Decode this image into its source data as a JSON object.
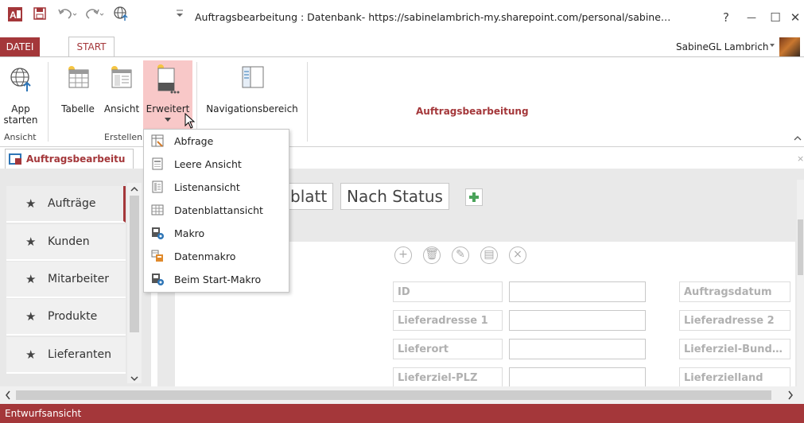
{
  "window": {
    "title": "Auftragsbearbeitung : Datenbank- https://sabinelambrich-my.sharepoint.com/personal/sabine…",
    "help": "?",
    "minimize": "—",
    "maximize": "☐",
    "close": "✕"
  },
  "tabs": {
    "datei": "DATEI",
    "start": "START"
  },
  "user": {
    "name": "SabineGL Lambrich"
  },
  "ribbon": {
    "app_starten_1": "App",
    "app_starten_2": "starten",
    "tabelle": "Tabelle",
    "ansicht": "Ansicht",
    "erweitert": "Erweitert",
    "navigationsbereich": "Navigationsbereich",
    "group_ansicht": "Ansicht",
    "group_erstellen": "Erstellen",
    "app_name": "Auftragsbearbeitung"
  },
  "dropdown": {
    "items": [
      {
        "label": "Abfrage",
        "icon": "query-icon"
      },
      {
        "label": "Leere Ansicht",
        "icon": "blank-view-icon"
      },
      {
        "label": "Listenansicht",
        "icon": "list-view-icon"
      },
      {
        "label": "Datenblattansicht",
        "icon": "datasheet-view-icon"
      },
      {
        "label": "Makro",
        "icon": "macro-icon"
      },
      {
        "label": "Datenmakro",
        "icon": "data-macro-icon"
      },
      {
        "label": "Beim Start-Makro",
        "icon": "startup-macro-icon"
      }
    ]
  },
  "doc_tab": {
    "label": "Auftragsbearbeitu"
  },
  "nav": {
    "items": [
      "Aufträge",
      "Kunden",
      "Mitarbeiter",
      "Produkte",
      "Lieferanten"
    ]
  },
  "views": {
    "datasheet_partial": "blatt",
    "nach_status": "Nach Status",
    "add": "+"
  },
  "form": {
    "fields_left": [
      "ID",
      "Lieferadresse 1",
      "Lieferort",
      "Lieferziel-PLZ"
    ],
    "fields_right": [
      "Auftragsdatum",
      "Lieferadresse 2",
      "Lieferziel-Bund…",
      "Lieferzielland"
    ]
  },
  "status": {
    "text": "Entwurfsansicht"
  },
  "colors": {
    "accent": "#a4373a",
    "highlight": "#f8c8c8"
  }
}
